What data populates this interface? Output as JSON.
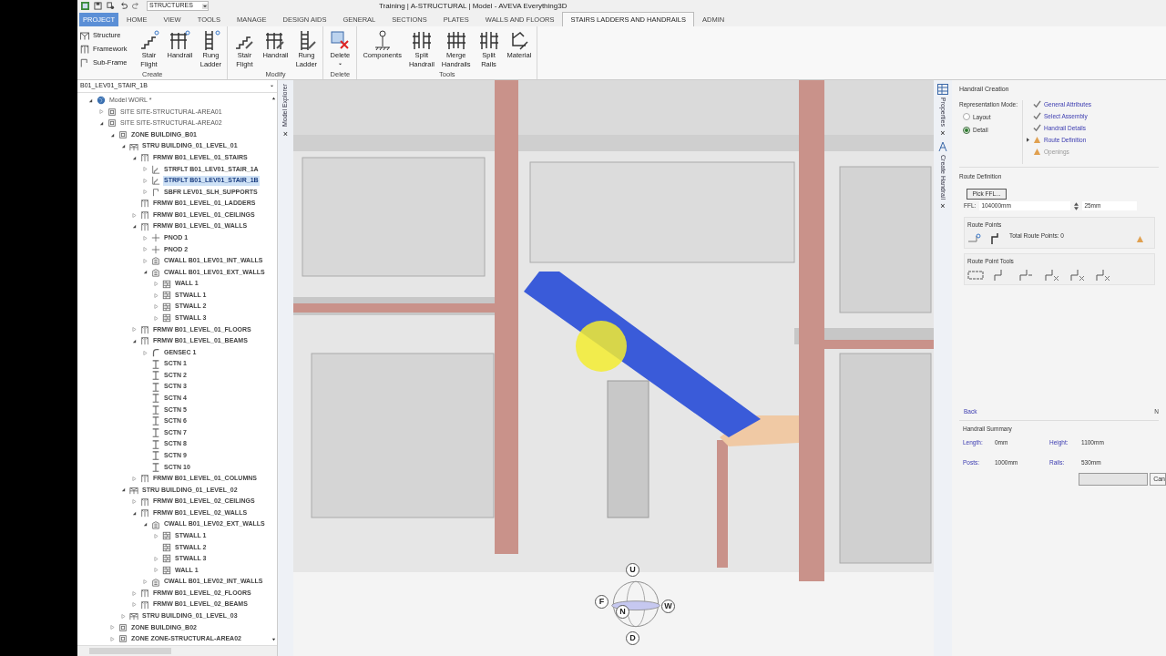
{
  "quick_access": {
    "dropdown_value": "STRUCTURES"
  },
  "window": {
    "title": "Training | A-STRUCTURAL | Model - AVEVA Everything3D"
  },
  "tabs": [
    {
      "label": "PROJECT",
      "kind": "app",
      "selected": false
    },
    {
      "label": "HOME",
      "kind": "tab",
      "selected": false
    },
    {
      "label": "VIEW",
      "kind": "tab",
      "selected": false
    },
    {
      "label": "TOOLS",
      "kind": "tab",
      "selected": false
    },
    {
      "label": "MANAGE",
      "kind": "tab",
      "selected": false
    },
    {
      "label": "DESIGN AIDS",
      "kind": "tab",
      "selected": false
    },
    {
      "label": "GENERAL",
      "kind": "tab",
      "selected": false
    },
    {
      "label": "SECTIONS",
      "kind": "tab",
      "selected": false
    },
    {
      "label": "PLATES",
      "kind": "tab",
      "selected": false
    },
    {
      "label": "WALLS AND FLOORS",
      "kind": "tab",
      "selected": false
    },
    {
      "label": "STAIRS LADDERS AND HANDRAILS",
      "kind": "tab",
      "selected": true
    },
    {
      "label": "ADMIN",
      "kind": "tab",
      "selected": false
    }
  ],
  "ribbon": [
    {
      "label": "Create",
      "small": [
        {
          "label": "Structure",
          "kind": "structure"
        },
        {
          "label": "Framework",
          "kind": "framework"
        },
        {
          "label": "Sub-Frame",
          "kind": "subframe"
        }
      ],
      "large": [
        {
          "lines": [
            "Stair",
            "Flight"
          ],
          "kind": "stair"
        },
        {
          "lines": [
            "Handrail"
          ],
          "kind": "handrail"
        },
        {
          "lines": [
            "Rung",
            "Ladder"
          ],
          "kind": "ladder"
        }
      ]
    },
    {
      "label": "Modify",
      "large": [
        {
          "lines": [
            "Stair",
            "Flight"
          ],
          "kind": "stair"
        },
        {
          "lines": [
            "Handrail"
          ],
          "kind": "handrail"
        },
        {
          "lines": [
            "Rung",
            "Ladder"
          ],
          "kind": "ladder"
        }
      ]
    },
    {
      "label": "Delete",
      "large": [
        {
          "lines": [
            "Delete"
          ],
          "kind": "delete",
          "menu": true
        }
      ]
    },
    {
      "label": "Tools",
      "large": [
        {
          "lines": [
            "Components"
          ],
          "kind": "components"
        },
        {
          "lines": [
            "Split",
            "Handrail"
          ],
          "kind": "split"
        },
        {
          "lines": [
            "Merge",
            "Handrails"
          ],
          "kind": "merge"
        },
        {
          "lines": [
            "Split",
            "Rails"
          ],
          "kind": "split"
        },
        {
          "lines": [
            "Material"
          ],
          "kind": "material"
        }
      ]
    }
  ],
  "explorer": {
    "search_value": "B01_LEV01_STAIR_1B",
    "tab_label": "Model Explorer",
    "close": "×",
    "tree": [
      {
        "label": "Model WORL *",
        "kind": "world",
        "expanded": true,
        "selected": false,
        "children": [
          {
            "label": "SITE SITE-STRUCTURAL-AREA01",
            "kind": "site",
            "expanded": false,
            "selected": false
          },
          {
            "label": "SITE SITE-STRUCTURAL-AREA02",
            "kind": "site",
            "expanded": true,
            "selected": false,
            "children": [
              {
                "label": "ZONE BUILDING_B01",
                "kind": "zone",
                "expanded": true,
                "selected": false,
                "children": [
                  {
                    "label": "STRU BUILDING_01_LEVEL_01",
                    "kind": "stru",
                    "expanded": true,
                    "selected": false,
                    "children": [
                      {
                        "label": "FRMW B01_LEVEL_01_STAIRS",
                        "kind": "frmw",
                        "expanded": true,
                        "selected": false,
                        "children": [
                          {
                            "label": "STRFLT B01_LEV01_STAIR_1A",
                            "kind": "strflt",
                            "expanded": false,
                            "selected": false
                          },
                          {
                            "label": "STRFLT B01_LEV01_STAIR_1B",
                            "kind": "strflt",
                            "expanded": false,
                            "selected": true
                          },
                          {
                            "label": "SBFR LEV01_SLH_SUPPORTS",
                            "kind": "sbfr",
                            "expanded": false,
                            "selected": false
                          }
                        ]
                      },
                      {
                        "label": "FRMW B01_LEVEL_01_LADDERS",
                        "kind": "frmw",
                        "selected": false
                      },
                      {
                        "label": "FRMW B01_LEVEL_01_CEILINGS",
                        "kind": "frmw",
                        "expanded": false,
                        "selected": false
                      },
                      {
                        "label": "FRMW B01_LEVEL_01_WALLS",
                        "kind": "frmw",
                        "expanded": true,
                        "selected": false,
                        "children": [
                          {
                            "label": "PNOD 1",
                            "kind": "pnod",
                            "expanded": false,
                            "selected": false
                          },
                          {
                            "label": "PNOD 2",
                            "kind": "pnod",
                            "expanded": false,
                            "selected": false
                          },
                          {
                            "label": "CWALL B01_LEV01_INT_WALLS",
                            "kind": "cwall",
                            "expanded": false,
                            "selected": false
                          },
                          {
                            "label": "CWALL B01_LEV01_EXT_WALLS",
                            "kind": "cwall",
                            "expanded": true,
                            "selected": false,
                            "children": [
                              {
                                "label": "WALL 1",
                                "kind": "wall",
                                "expanded": false,
                                "selected": false
                              },
                              {
                                "label": "STWALL 1",
                                "kind": "wall",
                                "expanded": false,
                                "selected": false
                              },
                              {
                                "label": "STWALL 2",
                                "kind": "wall",
                                "expanded": false,
                                "selected": false
                              },
                              {
                                "label": "STWALL 3",
                                "kind": "wall",
                                "expanded": false,
                                "selected": false
                              }
                            ]
                          }
                        ]
                      },
                      {
                        "label": "FRMW B01_LEVEL_01_FLOORS",
                        "kind": "frmw",
                        "expanded": false,
                        "selected": false
                      },
                      {
                        "label": "FRMW B01_LEVEL_01_BEAMS",
                        "kind": "frmw",
                        "expanded": true,
                        "selected": false,
                        "children": [
                          {
                            "label": "GENSEC 1",
                            "kind": "gensec",
                            "expanded": false,
                            "selected": false
                          },
                          {
                            "label": "SCTN 1",
                            "kind": "sctn",
                            "selected": false
                          },
                          {
                            "label": "SCTN 2",
                            "kind": "sctn",
                            "selected": false
                          },
                          {
                            "label": "SCTN 3",
                            "kind": "sctn",
                            "selected": false
                          },
                          {
                            "label": "SCTN 4",
                            "kind": "sctn",
                            "selected": false
                          },
                          {
                            "label": "SCTN 5",
                            "kind": "sctn",
                            "selected": false
                          },
                          {
                            "label": "SCTN 6",
                            "kind": "sctn",
                            "selected": false
                          },
                          {
                            "label": "SCTN 7",
                            "kind": "sctn",
                            "selected": false
                          },
                          {
                            "label": "SCTN 8",
                            "kind": "sctn",
                            "selected": false
                          },
                          {
                            "label": "SCTN 9",
                            "kind": "sctn",
                            "selected": false
                          },
                          {
                            "label": "SCTN 10",
                            "kind": "sctn",
                            "selected": false
                          }
                        ]
                      },
                      {
                        "label": "FRMW B01_LEVEL_01_COLUMNS",
                        "kind": "frmw",
                        "expanded": false,
                        "selected": false
                      }
                    ]
                  },
                  {
                    "label": "STRU BUILDING_01_LEVEL_02",
                    "kind": "stru",
                    "expanded": true,
                    "selected": false,
                    "children": [
                      {
                        "label": "FRMW B01_LEVEL_02_CEILINGS",
                        "kind": "frmw",
                        "expanded": false,
                        "selected": false
                      },
                      {
                        "label": "FRMW B01_LEVEL_02_WALLS",
                        "kind": "frmw",
                        "expanded": true,
                        "selected": false,
                        "children": [
                          {
                            "label": "CWALL B01_LEV02_EXT_WALLS",
                            "kind": "cwall",
                            "expanded": true,
                            "selected": false,
                            "children": [
                              {
                                "label": "STWALL 1",
                                "kind": "wall",
                                "expanded": false,
                                "selected": false
                              },
                              {
                                "label": "STWALL 2",
                                "kind": "wall",
                                "selected": false
                              },
                              {
                                "label": "STWALL 3",
                                "kind": "wall",
                                "expanded": false,
                                "selected": false
                              },
                              {
                                "label": "WALL 1",
                                "kind": "wall",
                                "expanded": false,
                                "selected": false
                              }
                            ]
                          },
                          {
                            "label": "CWALL B01_LEV02_INT_WALLS",
                            "kind": "cwall",
                            "expanded": false,
                            "selected": false
                          }
                        ]
                      },
                      {
                        "label": "FRMW B01_LEVEL_02_FLOORS",
                        "kind": "frmw",
                        "expanded": false,
                        "selected": false
                      },
                      {
                        "label": "FRMW B01_LEVEL_02_BEAMS",
                        "kind": "frmw",
                        "expanded": false,
                        "selected": false
                      }
                    ]
                  },
                  {
                    "label": "STRU BUILDING_01_LEVEL_03",
                    "kind": "stru",
                    "expanded": false,
                    "selected": false
                  }
                ]
              },
              {
                "label": "ZONE BUILDING_B02",
                "kind": "zone",
                "expanded": false,
                "selected": false
              },
              {
                "label": "ZONE ZONE-STRUCTURAL-AREA02",
                "kind": "zone",
                "expanded": false,
                "selected": false
              }
            ]
          }
        ]
      }
    ]
  },
  "view_cube": {
    "labels": [
      "U",
      "F",
      "N",
      "W",
      "D"
    ]
  },
  "side_tabs": [
    {
      "label": "Properties",
      "close": "×",
      "kind": "grid"
    },
    {
      "label": "Create Handrail",
      "close": "×",
      "kind": "handrail"
    }
  ],
  "handrail_panel": {
    "title": "Handrail Creation",
    "mode_label": "Representation Mode:",
    "modes": [
      {
        "label": "Layout",
        "selected": false
      },
      {
        "label": "Detail",
        "selected": true
      }
    ],
    "steps": [
      {
        "label": "General Attributes",
        "complete": true,
        "current": false,
        "disabled": false
      },
      {
        "label": "Select Assembly",
        "complete": true,
        "current": false,
        "disabled": false
      },
      {
        "label": "Handrail Details",
        "complete": true,
        "current": false,
        "disabled": false
      },
      {
        "label": "Route Definition",
        "complete": false,
        "current": true,
        "disabled": false
      },
      {
        "label": "Openings",
        "complete": false,
        "current": false,
        "disabled": true
      }
    ],
    "section_title": "Route Definition",
    "pick_button": "Pick FFL...",
    "ffl_label": "FFL:",
    "ffl_value": "104000mm",
    "step_value": "25mm",
    "route_points_title": "Route Points",
    "route_points_text": "Total Route Points: 0",
    "tools_title": "Route Point Tools",
    "back_link": "Back",
    "next_cut": "N",
    "summary_title": "Handrail Summary",
    "summary": [
      {
        "label": "Length:",
        "value": "0mm"
      },
      {
        "label": "Height:",
        "value": "1100mm"
      },
      {
        "label": "Posts:",
        "value": "1000mm"
      },
      {
        "label": "Rails:",
        "value": "530mm"
      }
    ],
    "cancel_cut": "Can"
  }
}
